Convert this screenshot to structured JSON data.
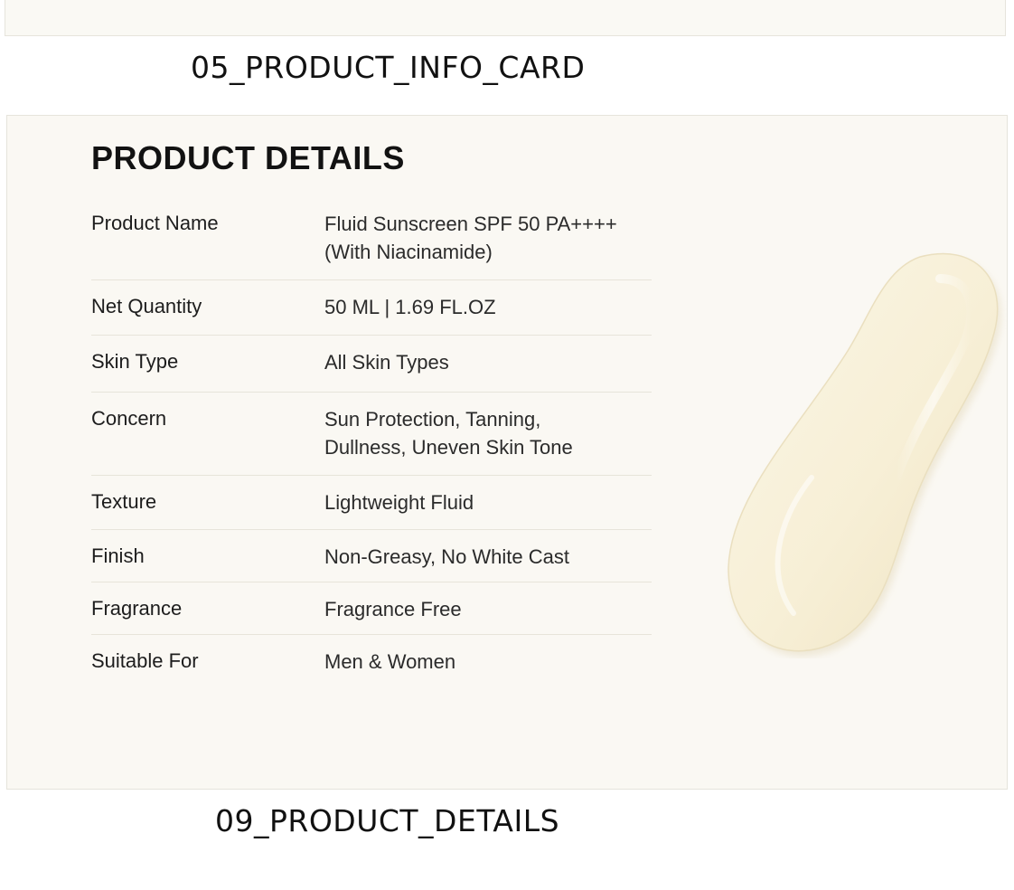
{
  "top_caption": "05_PRODUCT_INFO_CARD",
  "bottom_caption": "09_PRODUCT_DETAILS",
  "card": {
    "title": "PRODUCT DETAILS",
    "rows": [
      {
        "label": "Product Name",
        "value": "Fluid Sunscreen SPF 50 PA++++\n(With Niacinamide)"
      },
      {
        "label": "Net Quantity",
        "value": "50 ML | 1.69 FL.OZ"
      },
      {
        "label": "Skin Type",
        "value": "All Skin Types"
      },
      {
        "label": "Concern",
        "value": "Sun Protection, Tanning,\nDullness, Uneven Skin Tone"
      },
      {
        "label": "Texture",
        "value": "Lightweight Fluid"
      },
      {
        "label": "Finish",
        "value": "Non-Greasy, No White Cast"
      },
      {
        "label": "Fragrance",
        "value": "Fragrance Free"
      },
      {
        "label": "Suitable For",
        "value": "Men & Women"
      }
    ]
  },
  "colors": {
    "card_background": "#faf8f3",
    "swatch_cream": "#f7efd6"
  }
}
